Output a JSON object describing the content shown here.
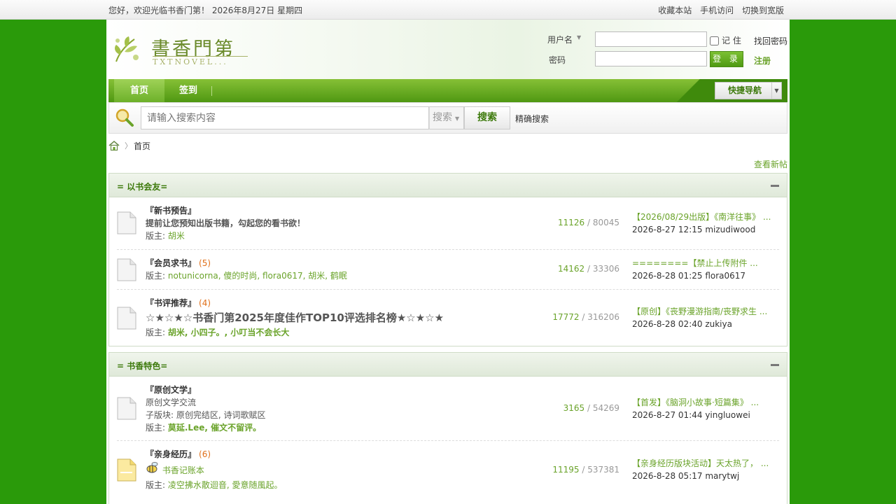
{
  "topbar": {
    "welcome": "您好，欢迎光临书香门第！ 2026年8月27日 星期四",
    "links": [
      "收藏本站",
      "手机访问",
      "切换到宽版"
    ]
  },
  "logo": {
    "title": "書香門第",
    "subtitle": "TXTNOVEL..."
  },
  "login": {
    "username_label": "用户名",
    "password_label": "密码",
    "remember_label": "记 住",
    "find_password": "找回密码",
    "login_button": "登 录",
    "register": "注册"
  },
  "nav": {
    "home": "首页",
    "sign": "签到",
    "quick_nav": "快捷导航"
  },
  "search": {
    "placeholder": "请输入搜索内容",
    "scope": "搜索",
    "button": "搜索",
    "exact": "精确搜索"
  },
  "breadcrumb": {
    "current": "首页"
  },
  "view_new_posts": "查看新帖",
  "sections": [
    {
      "title": "= 以书会友=",
      "forums": [
        {
          "name": "『新书预告』",
          "count": "",
          "desc": "提前让您预知出版书籍，勾起您的看书欲！",
          "moderators_label": "版主:",
          "moderators": "胡米",
          "threads": "11126",
          "posts": "80045",
          "last_title": "【2026/08/29出版】《南洋往事》 ...",
          "last_meta": "2026-8-27 12:15 mizudiwood"
        },
        {
          "name": "『会员求书』",
          "count": "(5)",
          "moderators_label": "版主:",
          "moderators": "notunicorna, 傻的时尚, flora0617, 胡米, 鹤眠",
          "threads": "14162",
          "posts": "33306",
          "last_title": "========【禁止上传附件 ...",
          "last_meta": "2026-8-28 01:25 flora0617"
        },
        {
          "name": "『书评推荐』",
          "count": "(4)",
          "desc": "☆★☆★☆书香门第2025年度佳作TOP10评选排名榜★☆★☆★",
          "moderators_label": "版主:",
          "moderators": "胡米, 小四子。, 小叮当不会长大",
          "threads": "17772",
          "posts": "316206",
          "last_title": "【原创】《丧野漫游指南/丧野求生 ...",
          "last_meta": "2026-8-28 02:40 zukiya"
        }
      ]
    },
    {
      "title": "= 书香特色=",
      "forums": [
        {
          "name": "『原创文学』",
          "count": "",
          "desc": "原创文学交流",
          "sub_label": "子版块:",
          "sub": "原创完结区, 诗词歌赋区",
          "moderators_label": "版主:",
          "moderators": "莫延.Lee, 催文不留评。",
          "threads": "3165",
          "posts": "54269",
          "last_title": "【首发】《脑洞小故事·短篇集》 ...",
          "last_meta": "2026-8-27 01:44 yingluowei"
        },
        {
          "name": "『亲身经历』",
          "count": "(6)",
          "desc": "书香记账本",
          "moderators_label": "版主:",
          "moderators": "凌空拂水散迴音, 愛意随風起。",
          "threads": "11195",
          "posts": "537381",
          "last_title": "【亲身经历版块活动】天太热了， ...",
          "last_meta": "2026-8-28 05:17 marytwj"
        }
      ]
    }
  ],
  "colors": {
    "page_bg": "#2a9a0a",
    "accent": "#6aa32a",
    "nav": "#5fa81c"
  }
}
